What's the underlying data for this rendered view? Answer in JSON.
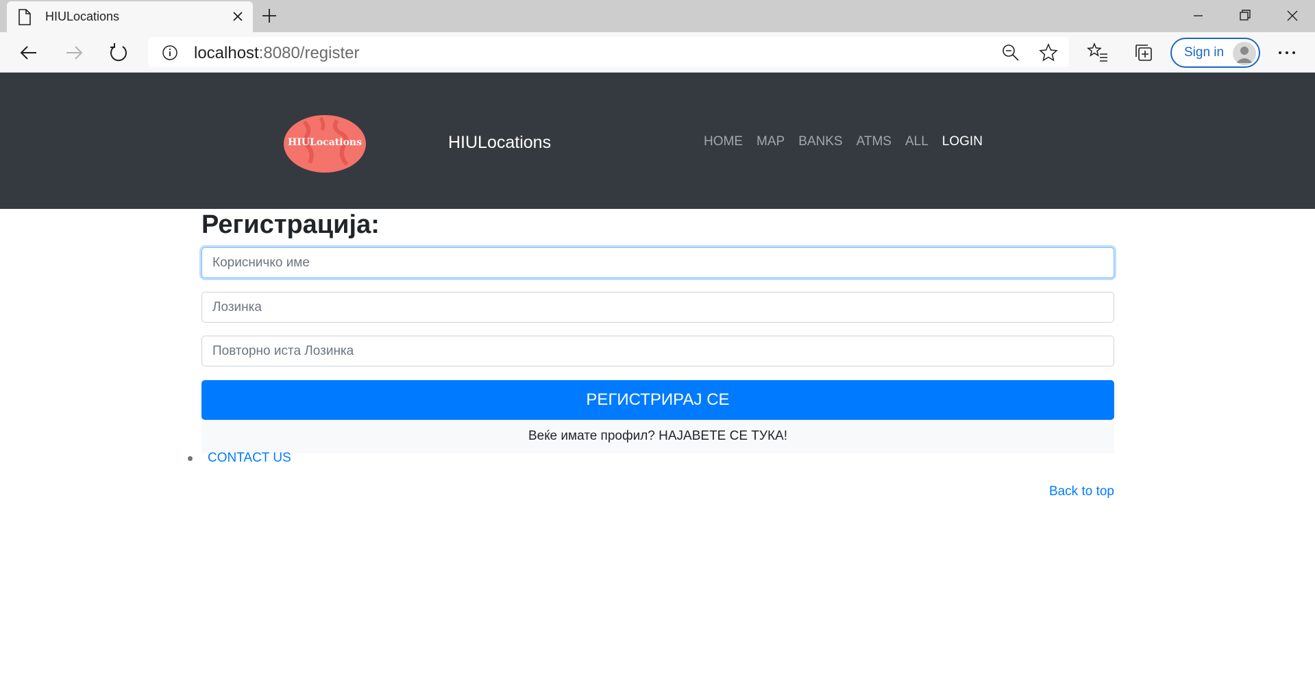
{
  "browser": {
    "tab_title": "HIULocations",
    "url_host": "localhost",
    "url_rest": ":8080/register",
    "signin_label": "Sign in"
  },
  "header": {
    "logo_text": "HIULocations",
    "brand": "HIULocations",
    "nav": [
      {
        "label": "HOME",
        "active": false
      },
      {
        "label": "MAP",
        "active": false
      },
      {
        "label": "BANKS",
        "active": false
      },
      {
        "label": "ATMS",
        "active": false
      },
      {
        "label": "ALL",
        "active": false
      },
      {
        "label": "LOGIN",
        "active": true
      }
    ]
  },
  "form": {
    "title": "Регистрација:",
    "username_placeholder": "Корисничко име",
    "password_placeholder": "Лозинка",
    "repeat_password_placeholder": "Повторно иста Лозинка",
    "submit_label": "РЕГИСТРИРАЈ СЕ",
    "login_hint": "Веќе имате профил? НАЈАВЕТЕ СЕ ТУКА!"
  },
  "footer": {
    "contact_label": "CONTACT US",
    "back_to_top": "Back to top"
  },
  "colors": {
    "header_bg": "#343a40",
    "primary": "#007bff",
    "logo_bg": "#f4736b"
  }
}
